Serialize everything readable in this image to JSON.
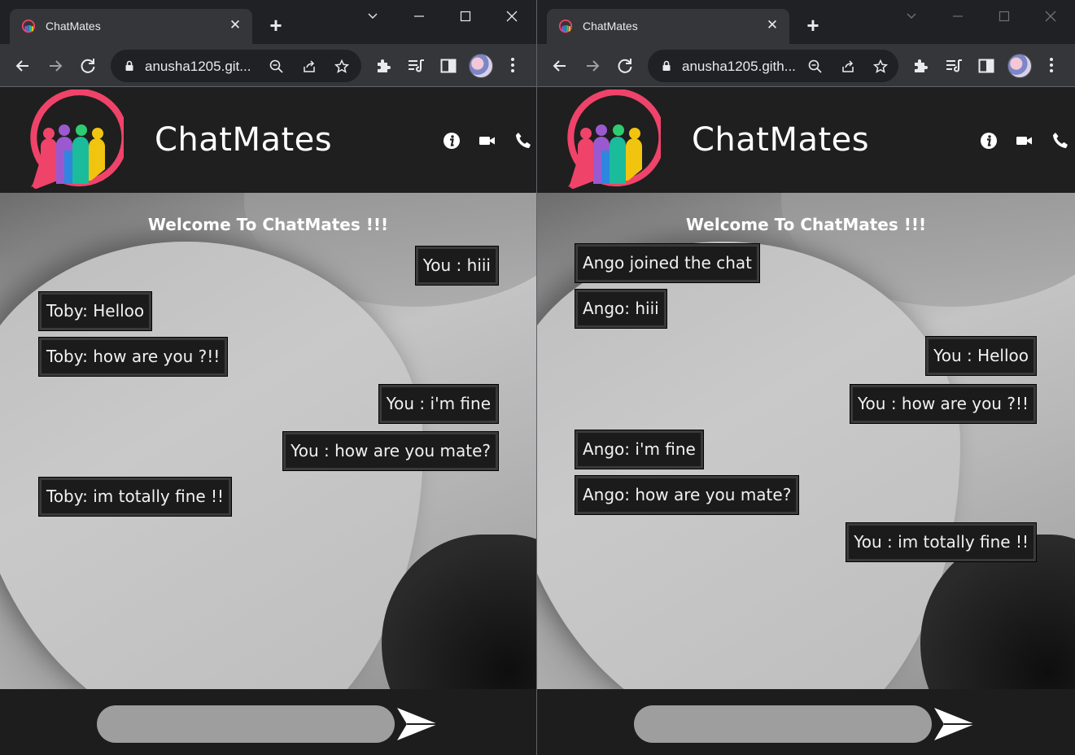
{
  "windows": [
    {
      "tab": {
        "title": "ChatMates",
        "close": "✕"
      },
      "new_tab": "+",
      "address": {
        "url": "anusha1205.git..."
      },
      "app": {
        "title": "ChatMates",
        "welcome": "Welcome To ChatMates !!!"
      },
      "messages": [
        {
          "text": "You : hiii",
          "side": "right"
        },
        {
          "text": "Toby: Helloo",
          "side": "left"
        },
        {
          "text": "Toby: how are you ?!!",
          "side": "left"
        },
        {
          "text": "You : i'm fine",
          "side": "right"
        },
        {
          "text": "You : how are you mate?",
          "side": "right"
        },
        {
          "text": "Toby: im totally fine !!",
          "side": "left"
        }
      ],
      "input": {
        "value": "",
        "placeholder": ""
      }
    },
    {
      "tab": {
        "title": "ChatMates",
        "close": "✕"
      },
      "new_tab": "+",
      "address": {
        "url": "anusha1205.gith..."
      },
      "app": {
        "title": "ChatMates",
        "welcome": "Welcome To ChatMates !!!"
      },
      "messages": [
        {
          "text": "Ango joined the chat",
          "side": "left"
        },
        {
          "text": "Ango: hiii",
          "side": "left"
        },
        {
          "text": "You : Helloo",
          "side": "right"
        },
        {
          "text": "You : how are you ?!!",
          "side": "right"
        },
        {
          "text": "Ango: i'm fine",
          "side": "left"
        },
        {
          "text": "Ango: how are you mate?",
          "side": "left"
        },
        {
          "text": "You : im totally fine !!",
          "side": "right"
        }
      ],
      "input": {
        "value": "",
        "placeholder": ""
      }
    }
  ],
  "icons": {
    "favicon": "chatmates-logo-icon",
    "back": "arrow-left-icon",
    "forward": "arrow-right-icon",
    "reload": "reload-icon",
    "lock": "lock-icon",
    "zoom": "zoom-icon",
    "share": "share-icon",
    "bookmark": "star-icon",
    "extensions": "puzzle-icon",
    "media": "media-control-icon",
    "side_panel": "side-panel-icon",
    "menu": "kebab-menu-icon",
    "info": "info-icon",
    "video": "video-call-icon",
    "phone": "phone-icon",
    "send": "send-icon"
  },
  "colors": {
    "browser_bg": "#202124",
    "toolbar": "#35363a",
    "header": "#1f1f1f",
    "bubble": "#1b1b1b",
    "input": "#9e9e9e",
    "logo_ring": "#f0436a"
  }
}
